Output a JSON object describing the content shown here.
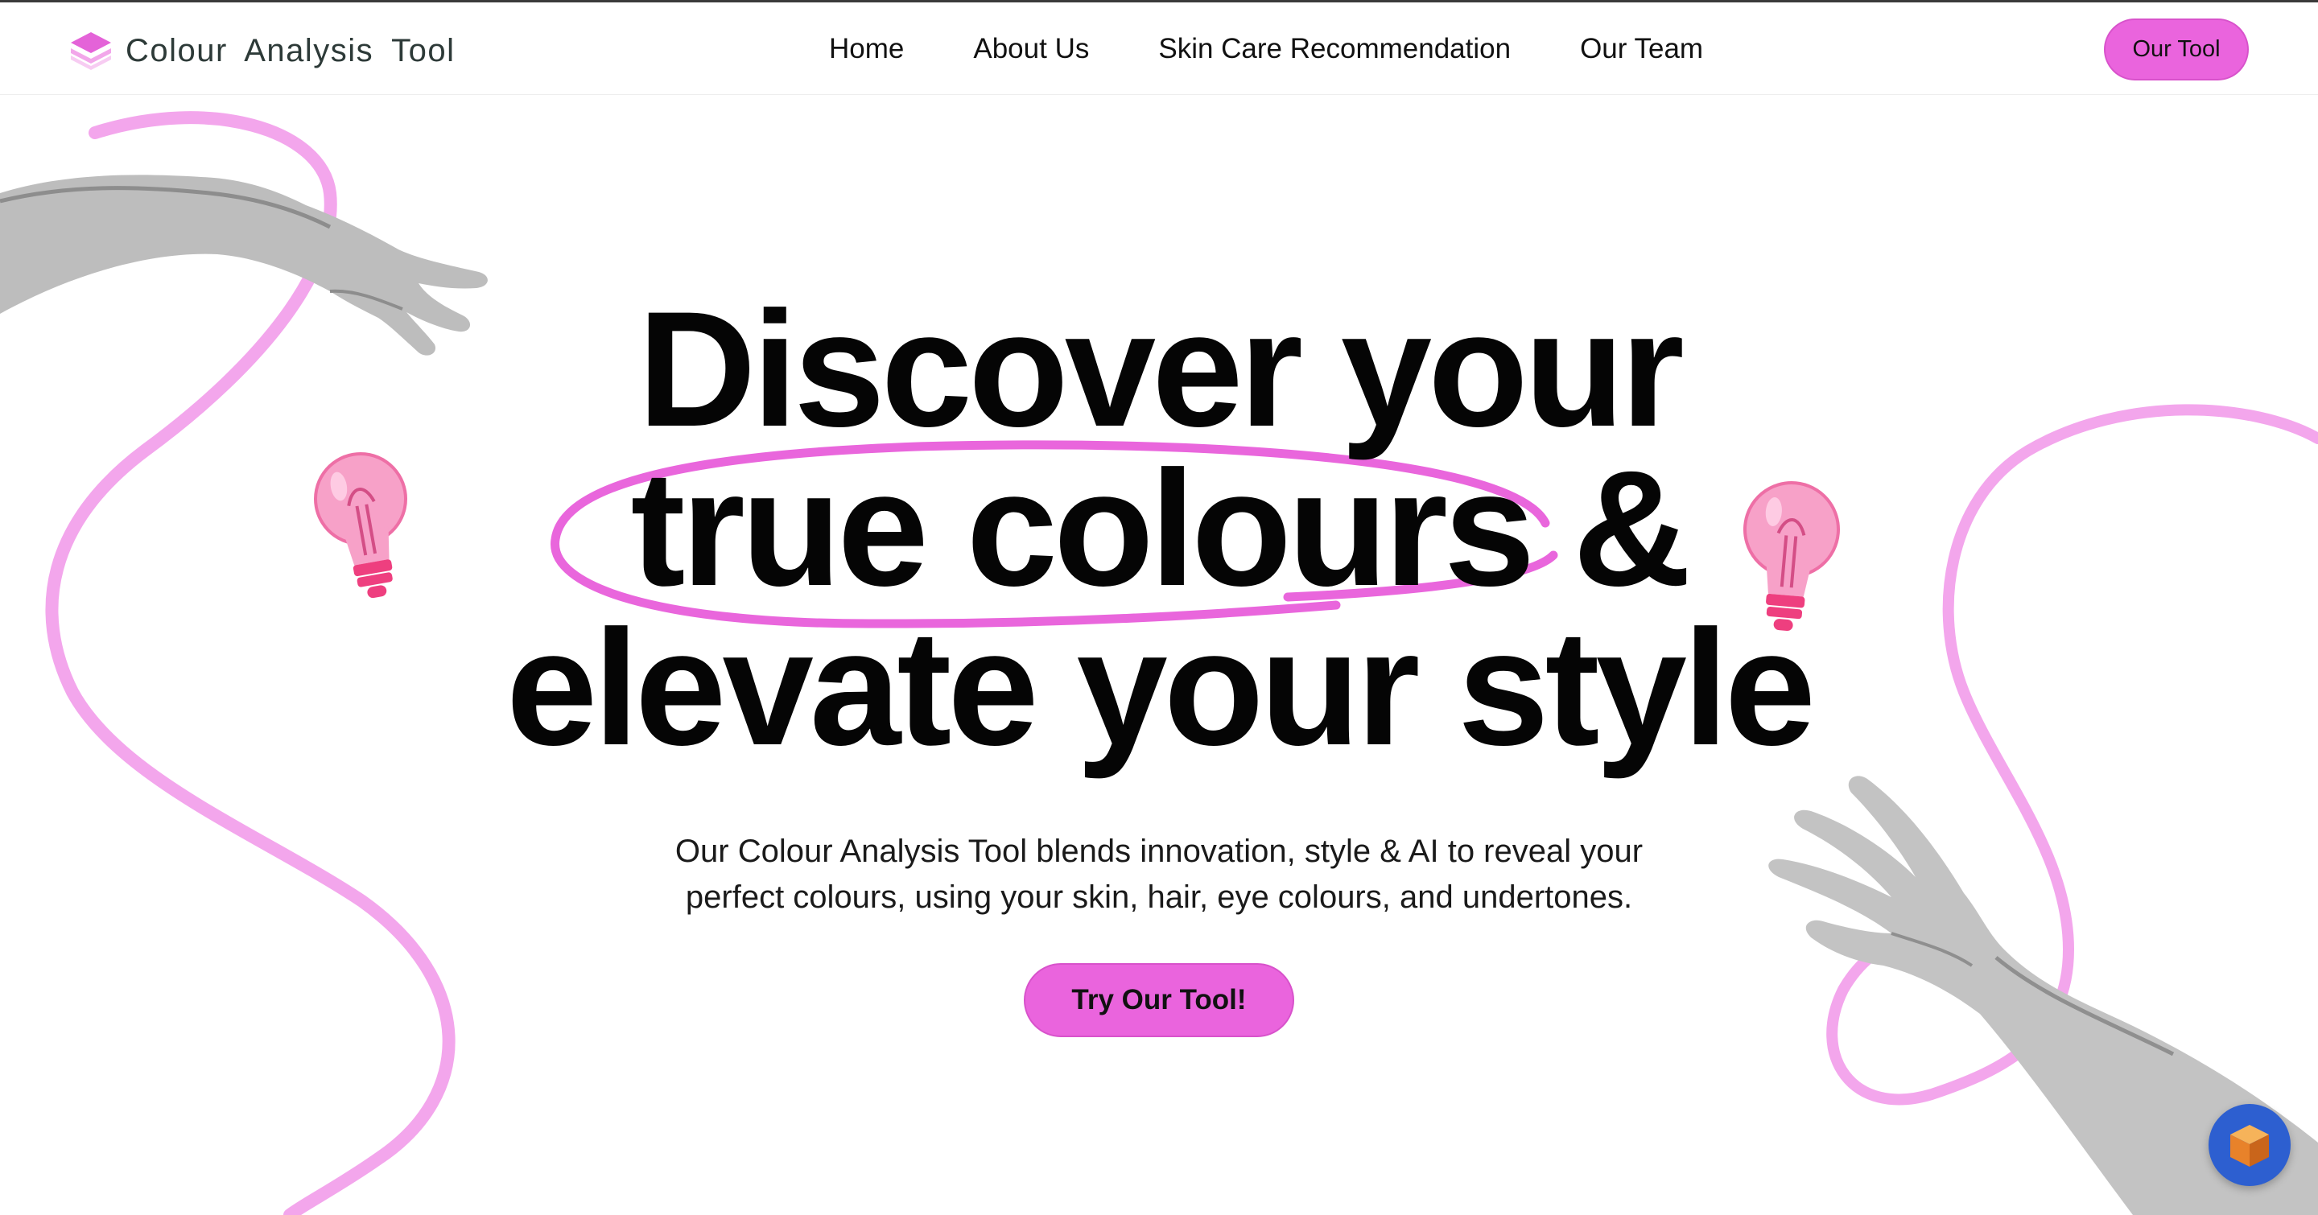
{
  "brand": {
    "name": "Colour Analysis Tool",
    "logo_icon": "layers-icon"
  },
  "nav": {
    "items": [
      "Home",
      "About Us",
      "Skin Care Recommendation",
      "Our Team"
    ],
    "cta_label": "Our Tool"
  },
  "hero": {
    "line1": "Discover your",
    "line2": "true colours &",
    "line3": "elevate your style",
    "description_line1": "Our Colour Analysis Tool blends innovation, style & AI to reveal your",
    "description_line2": "perfect colours, using your skin, hair, eye colours, and undertones.",
    "cta_label": "Try Our Tool!"
  },
  "decorations": {
    "left": [
      "hand-icon",
      "lightbulb-icon"
    ],
    "right": [
      "hand-icon",
      "lightbulb-icon"
    ]
  },
  "chat_widget": {
    "icon": "cube-icon"
  },
  "colors": {
    "accent": "#ea64dd",
    "swirl": "#f3a6ec",
    "text": "#050505",
    "widget": "#2d5fd0"
  }
}
